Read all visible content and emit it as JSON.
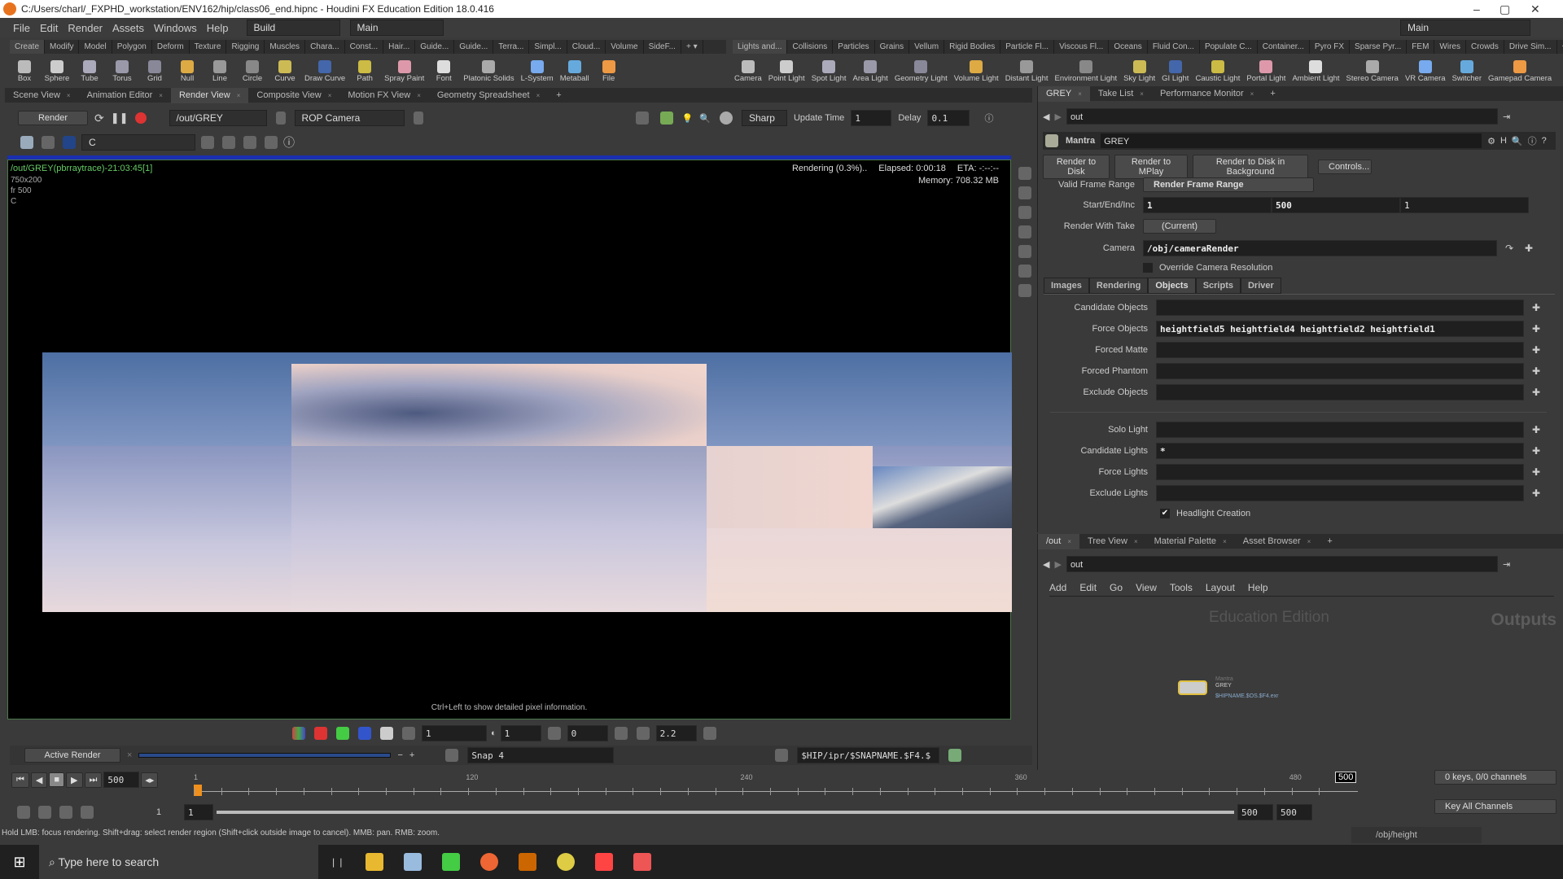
{
  "window": {
    "title": "C:/Users/charl/_FXPHD_workstation/ENV162/hip/class06_end.hipnc - Houdini FX Education Edition 18.0.416",
    "controls": [
      "–",
      "▢",
      "✕"
    ]
  },
  "menu": {
    "items": [
      "File",
      "Edit",
      "Render",
      "Assets",
      "Windows",
      "Help"
    ],
    "desktop": "Build",
    "context": "Main",
    "right_desktop": "Main"
  },
  "shelf_left": {
    "tabs": [
      "Create",
      "Modify",
      "Model",
      "Polygon",
      "Deform",
      "Texture",
      "Rigging",
      "Muscles",
      "Chara...",
      "Const...",
      "Hair...",
      "Guide...",
      "Guide...",
      "Terra...",
      "Simpl...",
      "Cloud...",
      "Volume",
      "SideF..."
    ],
    "tools": [
      "Box",
      "Sphere",
      "Tube",
      "Torus",
      "Grid",
      "Null",
      "Line",
      "Circle",
      "Curve",
      "Draw Curve",
      "Path",
      "Spray Paint",
      "Font",
      "Platonic Solids",
      "L-System",
      "Metaball",
      "File"
    ]
  },
  "shelf_right": {
    "tabs": [
      "Lights and...",
      "Collisions",
      "Particles",
      "Grains",
      "Vellum",
      "Rigid Bodies",
      "Particle Fl...",
      "Viscous Fl...",
      "Oceans",
      "Fluid Con...",
      "Populate C...",
      "Container...",
      "Pyro FX",
      "Sparse Pyr...",
      "FEM",
      "Wires",
      "Crowds",
      "Drive Sim..."
    ],
    "tools": [
      "Camera",
      "Point Light",
      "Spot Light",
      "Area Light",
      "Geometry Light",
      "Volume Light",
      "Distant Light",
      "Environment Light",
      "Sky Light",
      "GI Light",
      "Caustic Light",
      "Portal Light",
      "Ambient Light",
      "Stereo Camera",
      "VR Camera",
      "Switcher",
      "Gamepad Camera"
    ]
  },
  "left_panes": {
    "tabs": [
      "Scene View",
      "Animation Editor",
      "Render View",
      "Composite View",
      "Motion FX View",
      "Geometry Spreadsheet"
    ],
    "active": "Render View"
  },
  "render_toolbar": {
    "render_button": "Render",
    "rop": "/out/GREY",
    "camera": "ROP Camera",
    "filter": "Sharp",
    "update_time_label": "Update Time",
    "update_time": "1",
    "delay_label": "Delay",
    "delay": "0.1",
    "channel": "C"
  },
  "viewer": {
    "info": "/out/GREY(pbrraytrace)-21:03:45[1]",
    "resolution": "750x200",
    "frame": "fr 500",
    "channel": "C",
    "status": "Rendering (0.3%)..",
    "elapsed": "Elapsed: 0:00:18",
    "eta": "ETA: -:--:--",
    "memory": "Memory:  708.32 MB",
    "hint": "Ctrl+Left to show detailed pixel information.",
    "progress_percent": 0.3
  },
  "viewer_bottom": {
    "exposure": "1",
    "gamma_field": "1",
    "offset": "0",
    "gamma": "2.2"
  },
  "snapshot_bar": {
    "mode": "Active Render",
    "snap": "Snap 4",
    "path": "$HIP/ipr/$SNAPNAME.$F4.$"
  },
  "timeline": {
    "current_frame": "500",
    "ticks": [
      "1",
      "120",
      "240",
      "360",
      "480"
    ],
    "frame_marker": "500",
    "range_start": "1",
    "range_start2": "1",
    "range_end": "500",
    "range_end2": "500",
    "keys": "0 keys, 0/0 channels",
    "key_all": "Key All Channels"
  },
  "status": "Hold LMB: focus rendering. Shift+drag: select render region (Shift+click outside image to cancel). MMB: pan. RMB: zoom.",
  "right_panes": {
    "tabs": [
      "GREY",
      "Take List",
      "Performance Monitor"
    ],
    "path": "out"
  },
  "params": {
    "node_type": "Mantra",
    "node_name": "GREY",
    "buttons": [
      "Render to Disk",
      "Render to MPlay",
      "Render to Disk in Background",
      "Controls..."
    ],
    "valid_frame_range_label": "Valid Frame Range",
    "valid_frame_range": "Render Frame Range",
    "start_end_inc_label": "Start/End/Inc",
    "start": "1",
    "end": "500",
    "inc": "1",
    "take_label": "Render With Take",
    "take": "(Current)",
    "camera_label": "Camera",
    "camera": "/obj/cameraRender",
    "override_label": "Override Camera Resolution",
    "tabs": [
      "Images",
      "Rendering",
      "Objects",
      "Scripts",
      "Driver"
    ],
    "active_tab": "Objects",
    "object_rows": [
      {
        "label": "Candidate Objects",
        "value": ""
      },
      {
        "label": "Force Objects",
        "value": "heightfield5 heightfield4 heightfield2 heightfield1"
      },
      {
        "label": "Forced Matte",
        "value": ""
      },
      {
        "label": "Forced Phantom",
        "value": ""
      },
      {
        "label": "Exclude Objects",
        "value": ""
      }
    ],
    "light_rows": [
      {
        "label": "Solo Light",
        "value": ""
      },
      {
        "label": "Candidate Lights",
        "value": "*"
      },
      {
        "label": "Force Lights",
        "value": ""
      },
      {
        "label": "Exclude Lights",
        "value": ""
      }
    ],
    "headlight_label": "Headlight Creation",
    "headlight_checked": true
  },
  "network": {
    "tabs": [
      "/out",
      "Tree View",
      "Material Palette",
      "Asset Browser"
    ],
    "path": "out",
    "menu": [
      "Add",
      "Edit",
      "Go",
      "View",
      "Tools",
      "Layout",
      "Help"
    ],
    "watermark": "Education Edition",
    "context_label": "Outputs",
    "node": {
      "type": "Mantra",
      "name": "GREY",
      "output": "$HIPNAME.$OS.$F4.exr"
    },
    "bottom_path": "/obj/height"
  },
  "taskbar": {
    "search_placeholder": "Type here to search"
  }
}
